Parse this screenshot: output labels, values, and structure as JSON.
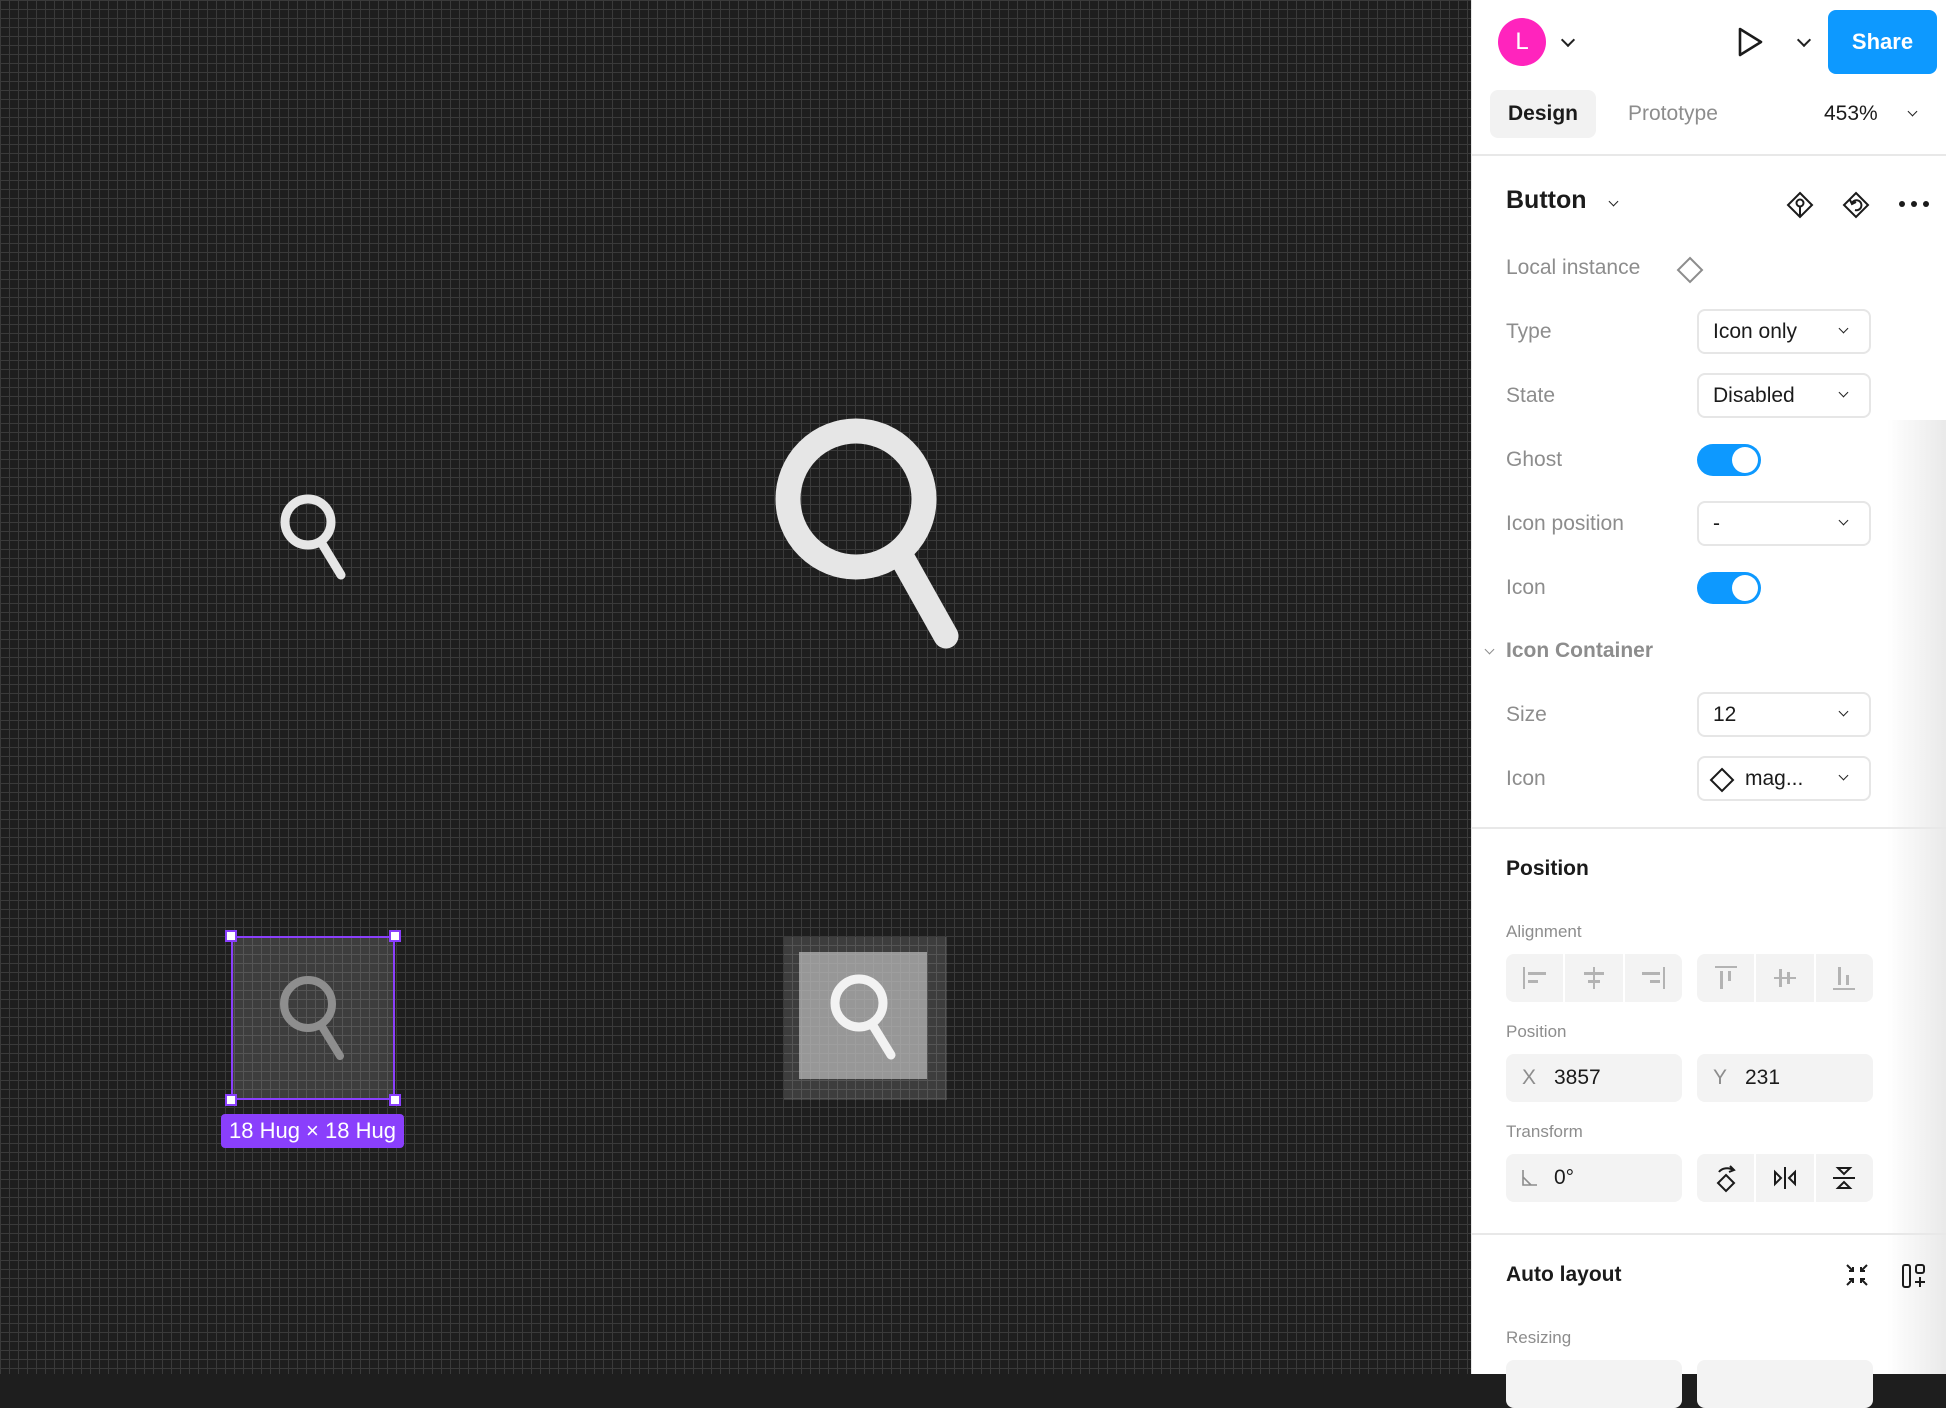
{
  "canvas": {
    "selection_label": "18 Hug × 18 Hug",
    "selection_color": "#8a3ffc",
    "icons": [
      "magnifying-glass-small",
      "magnifying-glass-large",
      "magnifying-glass-selected-button",
      "magnifying-glass-disabled-button"
    ]
  },
  "header": {
    "avatar_initial": "L",
    "avatar_color": "#ff24bd",
    "share_label": "Share",
    "share_color": "#0d99ff"
  },
  "tabs": {
    "design": "Design",
    "prototype": "Prototype",
    "zoom": "453%"
  },
  "component": {
    "title": "Button",
    "local_instance_label": "Local instance",
    "properties": [
      {
        "label": "Type",
        "value": "Icon only",
        "kind": "select"
      },
      {
        "label": "State",
        "value": "Disabled",
        "kind": "select"
      },
      {
        "label": "Ghost",
        "value": true,
        "kind": "toggle"
      },
      {
        "label": "Icon position",
        "value": "-",
        "kind": "select"
      },
      {
        "label": "Icon",
        "value": true,
        "kind": "toggle"
      }
    ],
    "nested": {
      "title": "Icon Container",
      "properties": [
        {
          "label": "Size",
          "value": "12",
          "kind": "select"
        },
        {
          "label": "Icon",
          "value": "mag...",
          "kind": "select"
        }
      ]
    }
  },
  "position": {
    "title": "Position",
    "alignment_label": "Alignment",
    "position_label": "Position",
    "x_prefix": "X",
    "x_value": "3857",
    "y_prefix": "Y",
    "y_value": "231",
    "transform_label": "Transform",
    "rotation": "0°"
  },
  "auto_layout": {
    "title": "Auto layout",
    "resizing_label": "Resizing"
  }
}
